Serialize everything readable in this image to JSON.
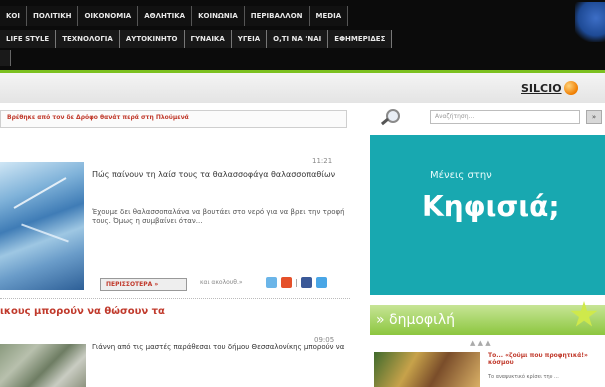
{
  "nav": {
    "row1": [
      "ΚΟΙ",
      "ΠΟΛΙΤΙΚΗ",
      "ΟΙΚΟΝΟΜΙΑ",
      "ΑΘΛΗΤΙΚΑ",
      "ΚΟΙΝΩΝΙΑ",
      "ΠΕΡΙΒΑΛΛΟΝ",
      "MEDIA"
    ],
    "row2": [
      "LIFE STYLE",
      "ΤΕΧΝΟΛΟΓΙΑ",
      "ΑΥΤΟΚΙΝΗΤΟ",
      "ΓΥΝΑΙΚΑ",
      "ΥΓΕΙΑ",
      "Ο,ΤΙ ΝΑ 'ΝΑΙ",
      "ΕΦΗΜΕΡΙΔΕΣ"
    ]
  },
  "logo": {
    "text": "SILCIO"
  },
  "headline_bar": {
    "text": "Βρέθηκε από τον δε Δρόφο θανάτ περά στη Πλούμενά"
  },
  "search": {
    "placeholder": "Αναζήτηση...",
    "button": "»"
  },
  "articles": [
    {
      "time": "11:21",
      "title": "Πώς παίνουν τη λαίσ τους τα θαλασσοφάγα θαλασσοπαθίων",
      "body": "Έχουμε δει θαλασσοπαλάνα να βουτάει στο νερό για να βρει την τροφή τους. Όμως η συμβαίνει όταν...",
      "more": "ΠΕΡΙΣΣΟΤΕΡΑ »",
      "share": "και ακολουθ.»"
    },
    {
      "time": "09:05",
      "title": "Γιάννη από τις μαστές παράθεσαι του δήμου Θεσσαλονίκης μπορούν να"
    }
  ],
  "red_headline": "ικους μπορούν να θώσουν τα",
  "banner": {
    "small": "Μένεις στην",
    "big": "Κηφισιά;"
  },
  "popular": {
    "label": "» δημοφιλή",
    "dots": "▲ ▲ ▲",
    "title": "Το... «ζούμι που προφητικά!» κόσμου",
    "sub": "Το αναψυκτικό κρίσει την ..."
  },
  "colors": {
    "accent_green": "#7cc020",
    "banner": "#18a8b0",
    "headline_red": "#c0392b"
  }
}
